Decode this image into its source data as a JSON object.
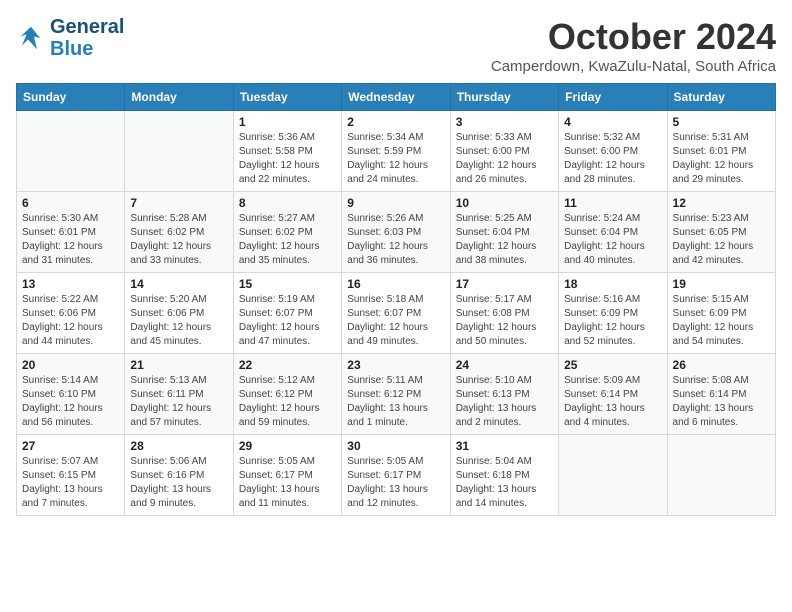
{
  "header": {
    "logo_line1": "General",
    "logo_line2": "Blue",
    "month_title": "October 2024",
    "subtitle": "Camperdown, KwaZulu-Natal, South Africa"
  },
  "weekdays": [
    "Sunday",
    "Monday",
    "Tuesday",
    "Wednesday",
    "Thursday",
    "Friday",
    "Saturday"
  ],
  "weeks": [
    [
      {
        "day": "",
        "info": ""
      },
      {
        "day": "",
        "info": ""
      },
      {
        "day": "1",
        "info": "Sunrise: 5:36 AM\nSunset: 5:58 PM\nDaylight: 12 hours and 22 minutes."
      },
      {
        "day": "2",
        "info": "Sunrise: 5:34 AM\nSunset: 5:59 PM\nDaylight: 12 hours and 24 minutes."
      },
      {
        "day": "3",
        "info": "Sunrise: 5:33 AM\nSunset: 6:00 PM\nDaylight: 12 hours and 26 minutes."
      },
      {
        "day": "4",
        "info": "Sunrise: 5:32 AM\nSunset: 6:00 PM\nDaylight: 12 hours and 28 minutes."
      },
      {
        "day": "5",
        "info": "Sunrise: 5:31 AM\nSunset: 6:01 PM\nDaylight: 12 hours and 29 minutes."
      }
    ],
    [
      {
        "day": "6",
        "info": "Sunrise: 5:30 AM\nSunset: 6:01 PM\nDaylight: 12 hours and 31 minutes."
      },
      {
        "day": "7",
        "info": "Sunrise: 5:28 AM\nSunset: 6:02 PM\nDaylight: 12 hours and 33 minutes."
      },
      {
        "day": "8",
        "info": "Sunrise: 5:27 AM\nSunset: 6:02 PM\nDaylight: 12 hours and 35 minutes."
      },
      {
        "day": "9",
        "info": "Sunrise: 5:26 AM\nSunset: 6:03 PM\nDaylight: 12 hours and 36 minutes."
      },
      {
        "day": "10",
        "info": "Sunrise: 5:25 AM\nSunset: 6:04 PM\nDaylight: 12 hours and 38 minutes."
      },
      {
        "day": "11",
        "info": "Sunrise: 5:24 AM\nSunset: 6:04 PM\nDaylight: 12 hours and 40 minutes."
      },
      {
        "day": "12",
        "info": "Sunrise: 5:23 AM\nSunset: 6:05 PM\nDaylight: 12 hours and 42 minutes."
      }
    ],
    [
      {
        "day": "13",
        "info": "Sunrise: 5:22 AM\nSunset: 6:06 PM\nDaylight: 12 hours and 44 minutes."
      },
      {
        "day": "14",
        "info": "Sunrise: 5:20 AM\nSunset: 6:06 PM\nDaylight: 12 hours and 45 minutes."
      },
      {
        "day": "15",
        "info": "Sunrise: 5:19 AM\nSunset: 6:07 PM\nDaylight: 12 hours and 47 minutes."
      },
      {
        "day": "16",
        "info": "Sunrise: 5:18 AM\nSunset: 6:07 PM\nDaylight: 12 hours and 49 minutes."
      },
      {
        "day": "17",
        "info": "Sunrise: 5:17 AM\nSunset: 6:08 PM\nDaylight: 12 hours and 50 minutes."
      },
      {
        "day": "18",
        "info": "Sunrise: 5:16 AM\nSunset: 6:09 PM\nDaylight: 12 hours and 52 minutes."
      },
      {
        "day": "19",
        "info": "Sunrise: 5:15 AM\nSunset: 6:09 PM\nDaylight: 12 hours and 54 minutes."
      }
    ],
    [
      {
        "day": "20",
        "info": "Sunrise: 5:14 AM\nSunset: 6:10 PM\nDaylight: 12 hours and 56 minutes."
      },
      {
        "day": "21",
        "info": "Sunrise: 5:13 AM\nSunset: 6:11 PM\nDaylight: 12 hours and 57 minutes."
      },
      {
        "day": "22",
        "info": "Sunrise: 5:12 AM\nSunset: 6:12 PM\nDaylight: 12 hours and 59 minutes."
      },
      {
        "day": "23",
        "info": "Sunrise: 5:11 AM\nSunset: 6:12 PM\nDaylight: 13 hours and 1 minute."
      },
      {
        "day": "24",
        "info": "Sunrise: 5:10 AM\nSunset: 6:13 PM\nDaylight: 13 hours and 2 minutes."
      },
      {
        "day": "25",
        "info": "Sunrise: 5:09 AM\nSunset: 6:14 PM\nDaylight: 13 hours and 4 minutes."
      },
      {
        "day": "26",
        "info": "Sunrise: 5:08 AM\nSunset: 6:14 PM\nDaylight: 13 hours and 6 minutes."
      }
    ],
    [
      {
        "day": "27",
        "info": "Sunrise: 5:07 AM\nSunset: 6:15 PM\nDaylight: 13 hours and 7 minutes."
      },
      {
        "day": "28",
        "info": "Sunrise: 5:06 AM\nSunset: 6:16 PM\nDaylight: 13 hours and 9 minutes."
      },
      {
        "day": "29",
        "info": "Sunrise: 5:05 AM\nSunset: 6:17 PM\nDaylight: 13 hours and 11 minutes."
      },
      {
        "day": "30",
        "info": "Sunrise: 5:05 AM\nSunset: 6:17 PM\nDaylight: 13 hours and 12 minutes."
      },
      {
        "day": "31",
        "info": "Sunrise: 5:04 AM\nSunset: 6:18 PM\nDaylight: 13 hours and 14 minutes."
      },
      {
        "day": "",
        "info": ""
      },
      {
        "day": "",
        "info": ""
      }
    ]
  ]
}
